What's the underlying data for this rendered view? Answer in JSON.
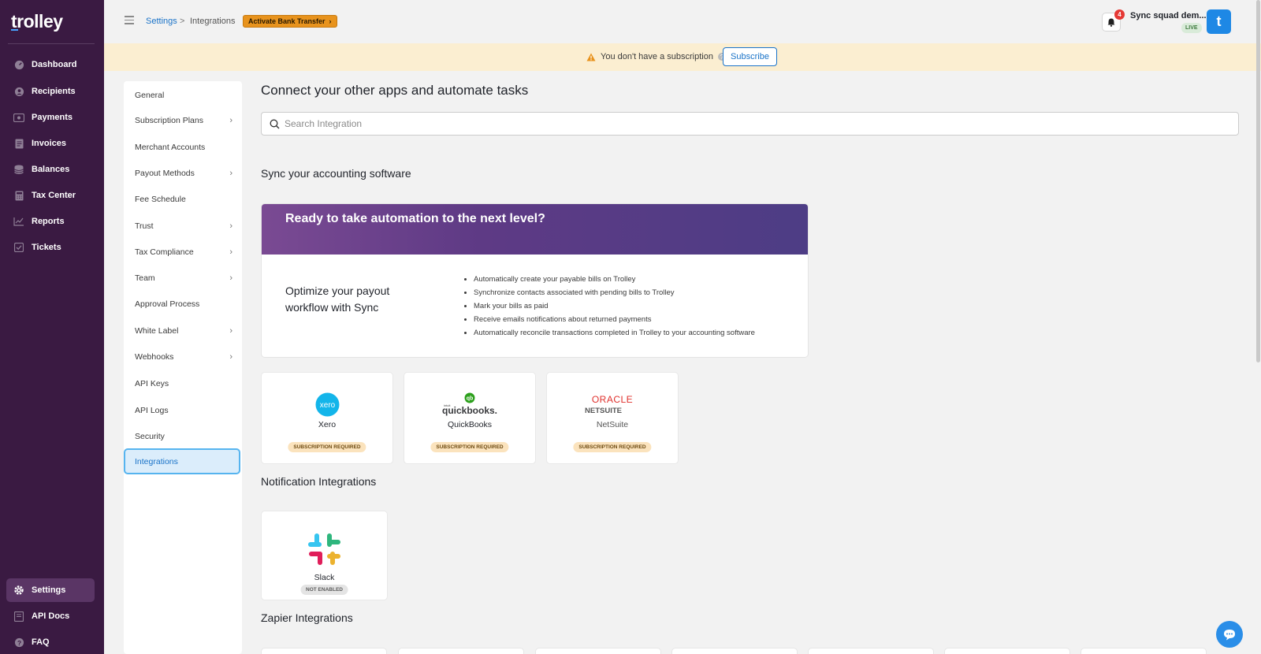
{
  "app": {
    "logo": "trolley"
  },
  "sidebar": {
    "items": [
      {
        "label": "Dashboard",
        "icon": "dashboard-icon"
      },
      {
        "label": "Recipients",
        "icon": "user-icon"
      },
      {
        "label": "Payments",
        "icon": "money-icon"
      },
      {
        "label": "Invoices",
        "icon": "document-icon"
      },
      {
        "label": "Balances",
        "icon": "database-icon"
      },
      {
        "label": "Tax Center",
        "icon": "calculator-icon"
      },
      {
        "label": "Reports",
        "icon": "chart-line-icon"
      },
      {
        "label": "Tickets",
        "icon": "checkbox-icon"
      }
    ],
    "bottom": [
      {
        "label": "Settings",
        "icon": "gear-icon",
        "active": true
      },
      {
        "label": "API Docs",
        "icon": "book-icon"
      },
      {
        "label": "FAQ",
        "icon": "help-icon"
      }
    ]
  },
  "header": {
    "breadcrumb_parent": "Settings",
    "breadcrumb_separator": ">",
    "breadcrumb_current": "Integrations",
    "activate_button": "Activate Bank Transfer",
    "notification_count": "4",
    "account_name": "Sync squad dem...",
    "env_badge": "LIVE",
    "avatar_letter": "t"
  },
  "banner": {
    "text": "You don't have a subscription",
    "help": "?",
    "button": "Subscribe"
  },
  "settings_nav": {
    "items": [
      {
        "label": "General",
        "chevron": false
      },
      {
        "label": "Subscription Plans",
        "chevron": true
      },
      {
        "label": "Merchant Accounts",
        "chevron": false
      },
      {
        "label": "Payout Methods",
        "chevron": true
      },
      {
        "label": "Fee Schedule",
        "chevron": false
      },
      {
        "label": "Trust",
        "chevron": true
      },
      {
        "label": "Tax Compliance",
        "chevron": true
      },
      {
        "label": "Team",
        "chevron": true
      },
      {
        "label": "Approval Process",
        "chevron": false
      },
      {
        "label": "White Label",
        "chevron": true
      },
      {
        "label": "Webhooks",
        "chevron": true
      },
      {
        "label": "API Keys",
        "chevron": false
      },
      {
        "label": "API Logs",
        "chevron": false
      },
      {
        "label": "Security",
        "chevron": false
      }
    ],
    "active": "Integrations"
  },
  "main": {
    "title": "Connect your other apps and automate tasks",
    "search_placeholder": "Search Integration",
    "accounting_title": "Sync your accounting software",
    "promo": {
      "heading": "Ready to take automation to the next level?",
      "left_text": "Optimize your payout workflow with Sync",
      "bullets": [
        "Automatically create your payable bills on Trolley",
        "Synchronize contacts associated with pending bills to Trolley",
        "Mark your bills as paid",
        "Receive emails notifications about returned payments",
        "Automatically reconcile transactions completed in Trolley to your accounting software"
      ]
    },
    "accounting_integrations": [
      {
        "name": "Xero",
        "badge": "SUBSCRIPTION REQUIRED",
        "logo_text": "xero"
      },
      {
        "name": "QuickBooks",
        "badge": "SUBSCRIPTION REQUIRED",
        "logo_text": "quickbooks.",
        "logo_small": "intuit",
        "logo_mark": "qb"
      },
      {
        "name": "NetSuite",
        "badge": "SUBSCRIPTION REQUIRED",
        "logo_text": "ORACLE",
        "logo_sub": "NETSUITE"
      }
    ],
    "notification_title": "Notification Integrations",
    "notification_integrations": [
      {
        "name": "Slack",
        "badge": "NOT ENABLED"
      }
    ],
    "zapier_title": "Zapier Integrations"
  },
  "colors": {
    "sidebar_bg": "#3a1a42",
    "accent": "#1a73c8",
    "banner_bg": "#fbeed1",
    "activate_orange": "#e8931d"
  }
}
